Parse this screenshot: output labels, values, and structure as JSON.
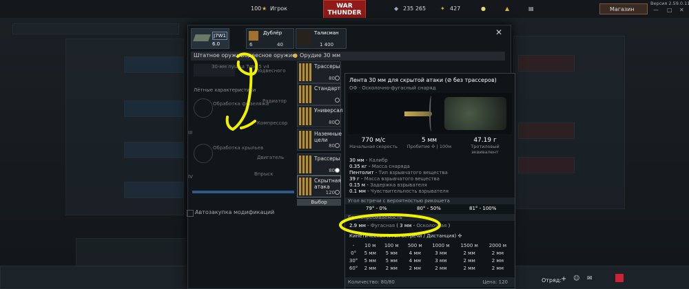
{
  "topbar": {
    "currency": "100",
    "player": "Игрок",
    "logo_top": "WAR",
    "logo_bottom": "THUNDER",
    "silver": "235 265",
    "gold": "427",
    "shop": "Магазин",
    "version": "Версия 2.59.0.11"
  },
  "slots": {
    "vehicle_name": "J7W1",
    "vehicle_br": "6.0",
    "backup_label": "Дублёр",
    "backup_count": "6",
    "backup_cost": "40",
    "talisman_label": "Талисман",
    "talisman_cost": "1 400"
  },
  "tabs": {
    "standard": "Штатное оружие",
    "suspended": "Подвесное оружие",
    "gun": "Орудие 30 мм"
  },
  "modules": {
    "flight": "Лётные характеристики",
    "gun_type": "30-мм пушка Type 5 v4",
    "pylon": "Подвесного",
    "fuselage": "Обработка фюзеляжа",
    "radiator": "Радиатор",
    "compressor": "Компрессор",
    "wings": "Обработка крыльев",
    "engine": "Двигатель",
    "injection": "Впрыск",
    "tier3": "III",
    "tier4": "IV",
    "autobuy": "Автозакупка модификаций"
  },
  "ammo": [
    {
      "label": "Трассеры",
      "count": "80",
      "selected": false
    },
    {
      "label": "Стандарт",
      "count": "",
      "selected": false
    },
    {
      "label": "Универсал",
      "count": "80",
      "selected": false
    },
    {
      "label": "Наземные цели",
      "count": "80",
      "selected": false
    },
    {
      "label": "Трассеры",
      "count": "80",
      "selected": true
    },
    {
      "label": "Скрытная атака",
      "count": "120",
      "selected": false
    }
  ],
  "select_button": "Выбор",
  "tooltip": {
    "title": "Лента 30 мм для скрытой атаки (",
    "title_tail": "без трассеров)",
    "subtitle_code": "ОФ",
    "subtitle": "Осколочно-фугасный снаряд",
    "speed_value": "770 м/с",
    "speed_label": "Начальная скорость",
    "pen_value": "5 мм",
    "pen_label": "Пробитие",
    "pen_dist": "100м",
    "tnt_value": "47.19 г",
    "tnt_label": "Тротиловый эквивалент",
    "specs": [
      {
        "v": "30 мм",
        "l": "Калибр"
      },
      {
        "v": "0.35 кг",
        "l": "Масса снаряда"
      },
      {
        "v": "Пентолит",
        "l": "Тип взрывчатого вещества"
      },
      {
        "v": "39 г",
        "l": "Масса взрывчатого вещества"
      },
      {
        "v": "0.15 м",
        "l": "Задержка взрывателя"
      },
      {
        "v": "0.1 мм",
        "l": "Чувствительность взрывателя"
      }
    ],
    "ricochet_header": "Угол встречи с вероятностью рикошета",
    "ricochet": [
      "79° - 0%",
      "80° - 50%",
      "81° - 100%"
    ],
    "armor_header": "Бронепробиваемость",
    "he_value": "2.9 мм",
    "he_label": "Фугасная",
    "frag_value": "3 мм",
    "frag_label": "Осколочная",
    "kinetic": "Кинетическая (Угол встречи / Дистанция)",
    "pen_cols": [
      "-",
      "10 м",
      "100 м",
      "500 м",
      "1000 м",
      "1500 м",
      "2000 м"
    ],
    "pen_rows": [
      [
        "0°",
        "5 мм",
        "5 мм",
        "4 мм",
        "3 мм",
        "2 мм",
        "2 мм"
      ],
      [
        "30°",
        "5 мм",
        "5 мм",
        "4 мм",
        "3 мм",
        "2 мм",
        "2 мм"
      ],
      [
        "60°",
        "2 мм",
        "2 мм",
        "2 мм",
        "2 мм",
        "2 мм",
        "2 мм"
      ]
    ],
    "quantity": "Количество: 80/80",
    "price": "Цена: 120"
  },
  "bottom": {
    "squad": "Отряд:"
  },
  "colors": {
    "annotation": "#f2f200",
    "accent_red": "#8f1a18"
  }
}
